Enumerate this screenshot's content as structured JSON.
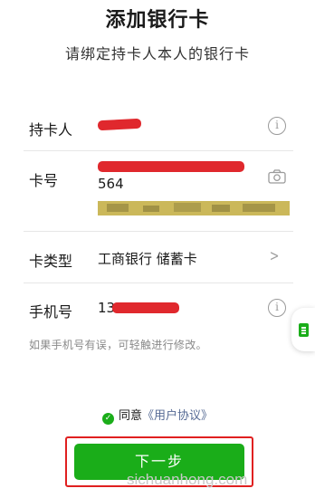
{
  "header": {
    "title": "添加银行卡",
    "subtitle": "请绑定持卡人本人的银行卡"
  },
  "form": {
    "holder": {
      "label": "持卡人",
      "info_icon": "info-icon",
      "info_glyph": "i"
    },
    "card_number": {
      "label": "卡号",
      "visible_digits": "564",
      "camera_icon": "camera-icon"
    },
    "card_type": {
      "label": "卡类型",
      "value": "工商银行 储蓄卡",
      "chevron_icon": "chevron-right-icon",
      "chevron_glyph": ">"
    },
    "phone": {
      "label": "手机号",
      "visible_prefix": "13",
      "info_icon": "info-icon",
      "info_glyph": "i"
    }
  },
  "hint": "如果手机号有误，可轻触进行修改。",
  "agreement": {
    "prefix": "同意",
    "link": "《用户协议》",
    "check_glyph": "✓"
  },
  "primary_button": {
    "label": "下一步"
  },
  "side_tab": {
    "icon": "document-icon"
  },
  "watermark": "sichuanhong.com",
  "colors": {
    "accent_green": "#1aad19",
    "link_blue": "#576b95",
    "redaction_red": "#e0282d",
    "highlight_frame": "#e02020"
  }
}
